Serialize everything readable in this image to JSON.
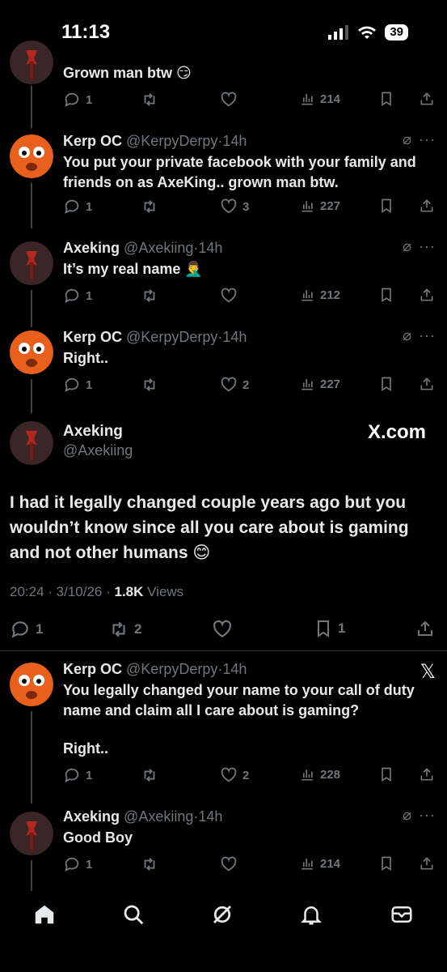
{
  "status_bar": {
    "time": "11:13",
    "battery": "39"
  },
  "posts": [
    {
      "text": "Grown man btw 😏",
      "replies": "1",
      "reposts": "",
      "likes": "",
      "views": "214"
    },
    {
      "name": "Kerp OC",
      "handle": "@KerpyDerpy",
      "time": "14h",
      "text": "You put your private facebook with your family and friends on as AxeKing.. grown man btw.",
      "replies": "1",
      "reposts": "",
      "likes": "3",
      "views": "227"
    },
    {
      "name": "Axeking",
      "handle": "@Axekiing",
      "time": "14h",
      "text": "It’s my real name 🤦‍♂️",
      "replies": "1",
      "reposts": "",
      "likes": "",
      "views": "212"
    },
    {
      "name": "Kerp OC",
      "handle": "@KerpyDerpy",
      "time": "14h",
      "text": "Right..",
      "replies": "1",
      "reposts": "",
      "likes": "2",
      "views": "227"
    },
    {
      "name": "Kerp OC",
      "handle": "@KerpyDerpy",
      "time": "14h",
      "text": "You legally changed your name to your call of duty name and claim all I care about is gaming?",
      "text2": "Right..",
      "replies": "1",
      "reposts": "",
      "likes": "2",
      "views": "228"
    },
    {
      "name": "Axeking",
      "handle": "@Axekiing",
      "time": "14h",
      "text": "Good Boy",
      "replies": "1",
      "reposts": "",
      "likes": "",
      "views": "214"
    }
  ],
  "focused_post": {
    "name": "Axeking",
    "handle": "@Axekiing",
    "watermark": "X.com",
    "text": "I had it legally changed couple years ago but you wouldn’t know since all you care about is gaming and not other humans 😊",
    "time_date": "20:24 · 3/10/26 · ",
    "views_count": "1.8K",
    "views_label": " Views",
    "replies": "1",
    "reposts": "2",
    "likes": "",
    "bookmarks": "1"
  },
  "dot_separator": "·",
  "grok_glyph": "⌀",
  "more_glyph": "···",
  "x_logo_glyph": "𝕏",
  "icons": [
    "reply-icon",
    "repost-icon",
    "like-icon",
    "views-icon",
    "bookmark-icon",
    "share-icon",
    "grok-icon",
    "more-icon",
    "home-icon",
    "search-icon",
    "notifications-icon",
    "messages-icon"
  ],
  "colors": {
    "background": "#000000",
    "text": "#e7e9ea",
    "secondary": "#71767b",
    "divider": "#2f3336"
  }
}
